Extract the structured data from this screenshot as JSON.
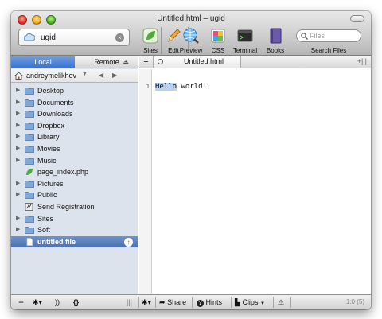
{
  "window": {
    "title": "Untitled.html – ugid"
  },
  "site": {
    "name": "ugid"
  },
  "toolbar": {
    "items": [
      {
        "label": "Sites",
        "icon": "leaf-icon"
      },
      {
        "label": "Edit",
        "icon": "pencil-icon"
      },
      {
        "label": "Preview",
        "icon": "globe-icon"
      },
      {
        "label": "CSS",
        "icon": "css-palette-icon"
      },
      {
        "label": "Terminal",
        "icon": "terminal-icon"
      },
      {
        "label": "Books",
        "icon": "book-icon"
      }
    ],
    "search_placeholder": "Files",
    "search_label": "Search Files"
  },
  "sidebar": {
    "tabs": {
      "local": "Local",
      "remote": "Remote"
    },
    "path": {
      "user": "andreymelikhov"
    },
    "items": [
      {
        "label": "Desktop",
        "type": "folder"
      },
      {
        "label": "Documents",
        "type": "folder"
      },
      {
        "label": "Downloads",
        "type": "folder"
      },
      {
        "label": "Dropbox",
        "type": "folder"
      },
      {
        "label": "Library",
        "type": "folder"
      },
      {
        "label": "Movies",
        "type": "folder"
      },
      {
        "label": "Music",
        "type": "folder"
      },
      {
        "label": "page_index.php",
        "type": "php"
      },
      {
        "label": "Pictures",
        "type": "folder"
      },
      {
        "label": "Public",
        "type": "folder"
      },
      {
        "label": "Send Registration",
        "type": "app"
      },
      {
        "label": "Sites",
        "type": "folder"
      },
      {
        "label": "Soft",
        "type": "folder"
      },
      {
        "label": "untitled file",
        "type": "file",
        "selected": true
      }
    ]
  },
  "editor": {
    "tab_name": "Untitled.html",
    "line_number": "1",
    "code_highlight": "Hello",
    "code_rest": " world!"
  },
  "bottombar": {
    "share": "Share",
    "hints": "Hints",
    "clips": "Clips",
    "status": "1:0 (5)"
  },
  "colors": {
    "sidebar_bg": "#dde3ec",
    "selection": "#4b71b0",
    "local_tab": "#3b72d2",
    "code_highlight": "#b7d4f7"
  }
}
